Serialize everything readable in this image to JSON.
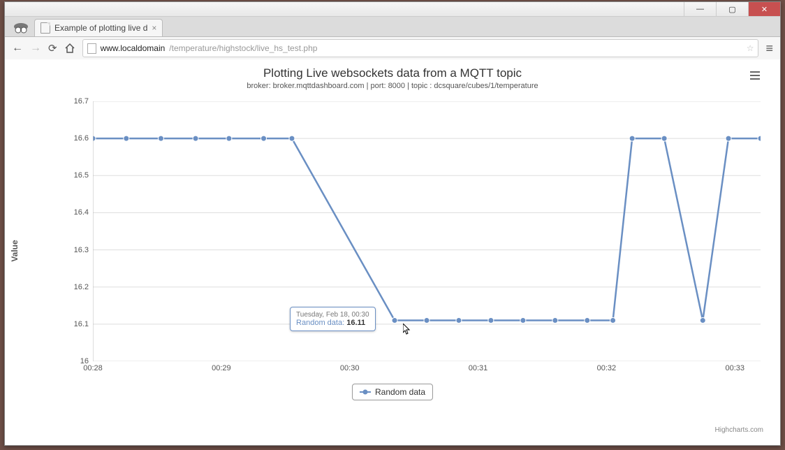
{
  "window": {
    "minimize": "—",
    "maximize": "▢",
    "close": "✕"
  },
  "tab": {
    "title": "Example of plotting live d",
    "close": "×"
  },
  "nav": {
    "back": "←",
    "forward": "→",
    "reload": "⟳",
    "home_icon": "home",
    "menu": "≡"
  },
  "url": {
    "host": "www.localdomain",
    "path": "/temperature/highstock/live_hs_test.php",
    "star": "☆"
  },
  "chart_data": {
    "type": "line",
    "title": "Plotting Live websockets data from a MQTT topic",
    "subtitle": "broker: broker.mqttdashboard.com | port: 8000 | topic : dcsquare/cubes/1/temperature",
    "ylabel": "Value",
    "xlabel": "",
    "ylim": [
      16.0,
      16.7
    ],
    "y_ticks": [
      16,
      16.1,
      16.2,
      16.3,
      16.4,
      16.5,
      16.6,
      16.7
    ],
    "x_ticks": [
      "00:28",
      "00:29",
      "00:30",
      "00:31",
      "00:32",
      "00:33"
    ],
    "x_range_minutes": [
      28,
      33.2
    ],
    "series": [
      {
        "name": "Random data",
        "color": "#6a8fc3",
        "points": [
          {
            "t": 28.0,
            "v": 16.6
          },
          {
            "t": 28.26,
            "v": 16.6
          },
          {
            "t": 28.53,
            "v": 16.6
          },
          {
            "t": 28.8,
            "v": 16.6
          },
          {
            "t": 29.06,
            "v": 16.6
          },
          {
            "t": 29.33,
            "v": 16.6
          },
          {
            "t": 29.55,
            "v": 16.6
          },
          {
            "t": 30.35,
            "v": 16.11
          },
          {
            "t": 30.6,
            "v": 16.11
          },
          {
            "t": 30.85,
            "v": 16.11
          },
          {
            "t": 31.1,
            "v": 16.11
          },
          {
            "t": 31.35,
            "v": 16.11
          },
          {
            "t": 31.6,
            "v": 16.11
          },
          {
            "t": 31.85,
            "v": 16.11
          },
          {
            "t": 32.05,
            "v": 16.11
          },
          {
            "t": 32.2,
            "v": 16.6
          },
          {
            "t": 32.45,
            "v": 16.6
          },
          {
            "t": 32.75,
            "v": 16.11
          },
          {
            "t": 32.95,
            "v": 16.6
          },
          {
            "t": 33.2,
            "v": 16.6
          }
        ]
      }
    ],
    "tooltip": {
      "header": "Tuesday, Feb 18, 00:30",
      "series": "Random data",
      "value": "16.11",
      "at_t": 30.35
    },
    "legend_label": "Random data",
    "credit": "Highcharts.com"
  }
}
